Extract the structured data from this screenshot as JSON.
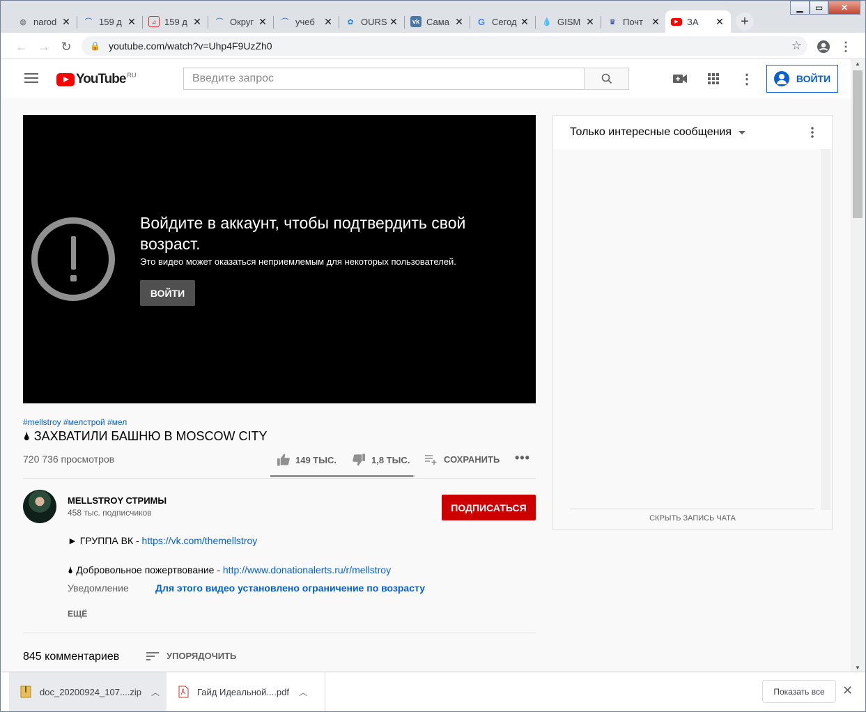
{
  "browser": {
    "tabs": [
      {
        "title": "narod",
        "icon": "globe"
      },
      {
        "title": "159 д",
        "icon": "swoosh"
      },
      {
        "title": "159 д",
        "icon": "pdf"
      },
      {
        "title": "Округ",
        "icon": "swoosh"
      },
      {
        "title": "учеб",
        "icon": "swoosh"
      },
      {
        "title": "OURS",
        "icon": "ours"
      },
      {
        "title": "Сама",
        "icon": "vk"
      },
      {
        "title": "Сегод",
        "icon": "google"
      },
      {
        "title": "GISM",
        "icon": "drop"
      },
      {
        "title": "Почт",
        "icon": "emblem"
      },
      {
        "title": "ЗА",
        "icon": "youtube"
      }
    ],
    "url": "youtube.com/watch?v=Uhp4F9UzZh0"
  },
  "youtube": {
    "logo_text": "YouTube",
    "region": "RU",
    "search_placeholder": "Введите запрос",
    "signin_label": "ВОЙТИ"
  },
  "player": {
    "title": "Войдите в аккаунт, чтобы подтвердить свой возраст.",
    "subtitle": "Это видео может оказаться неприемлемым для некоторых пользователей.",
    "button": "ВОЙТИ"
  },
  "video": {
    "tags": "#mellstroy #мелстрой #мел",
    "title": "🌢 ЗАХВАТИЛИ БАШНЮ В MOSCOW CITY",
    "views": "720 736 просмотров",
    "likes": "149 ТЫС.",
    "dislikes": "1,8 ТЫС.",
    "save": "СОХРАНИТЬ",
    "like_ratio": 0.988
  },
  "channel": {
    "name": "MELLSTROY СТРИМЫ",
    "subscribers": "458 тыс. подписчиков",
    "subscribe": "ПОДПИСАТЬСЯ"
  },
  "description": {
    "line1_text": "► ГРУППА ВК - ",
    "line1_link": "https://vk.com/themellstroy",
    "line2_text": "🌢 Добровольное пожертвование - ",
    "line2_link": "http://www.donationalerts.ru/r/mellstroy",
    "notice_label": "Уведомление",
    "notice_value": "Для этого видео установлено ограничение по возрасту",
    "more": "ЕЩЁ"
  },
  "comments": {
    "count": "845 комментариев",
    "sort": "УПОРЯДОЧИТЬ"
  },
  "chat": {
    "mode": "Только интересные сообщения",
    "hide": "СКРЫТЬ ЗАПИСЬ ЧАТА"
  },
  "downloads": {
    "items": [
      {
        "name": "doc_20200924_107....zip",
        "icon": "zip"
      },
      {
        "name": "Гайд Идеальной....pdf",
        "icon": "pdf"
      }
    ],
    "show_all": "Показать все"
  },
  "colors": {
    "accent": "#065fd4",
    "youtube_red": "#ff0000",
    "subscribe_red": "#cc0000"
  }
}
